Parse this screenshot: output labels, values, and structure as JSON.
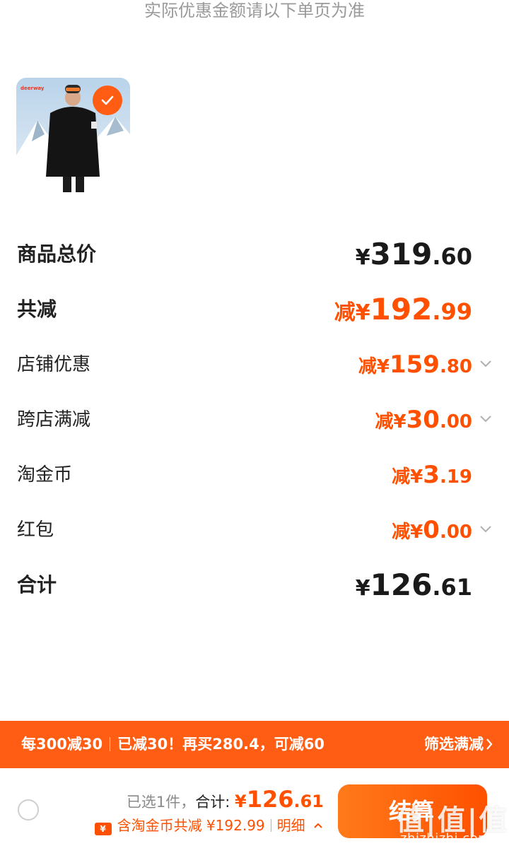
{
  "notice": "实际优惠金额请以下单页为准",
  "product": {
    "image_alt": "deerway",
    "selected": true
  },
  "rows": [
    {
      "label": "商品总价",
      "prefix": "¥",
      "int": "319",
      "dec": ".60",
      "style": "total"
    },
    {
      "label": "共减",
      "prefix": "减¥",
      "int": "192",
      "dec": ".99",
      "style": "discount-total"
    },
    {
      "label": "店铺优惠",
      "prefix": "减¥",
      "int": "159",
      "dec": ".80",
      "expandable": true
    },
    {
      "label": "跨店满减",
      "prefix": "减¥",
      "int": "30",
      "dec": ".00",
      "expandable": true
    },
    {
      "label": "淘金币",
      "prefix": "减¥",
      "int": "3",
      "dec": ".19",
      "expandable": false
    },
    {
      "label": "红包",
      "prefix": "减¥",
      "int": "0",
      "dec": ".00",
      "expandable": true
    },
    {
      "label": "合计",
      "prefix": "¥",
      "int": "126",
      "dec": ".61",
      "style": "total"
    }
  ],
  "promo": {
    "rule": "每300减30",
    "status": "已减30！再买280.4，可减60",
    "filter_label": "筛选满减"
  },
  "footer": {
    "selected_count": "已选1件，",
    "total_label": "合计: ",
    "total_prefix": "¥",
    "total_int": "126",
    "total_dec": ".61",
    "savings_text": "含淘金币共减 ¥192.99",
    "details_label": "明细",
    "checkout_label": "结算"
  },
  "watermark": {
    "logo": "值|值|值",
    "url": "zhizhizhi.com"
  },
  "colors": {
    "accent": "#ff5000",
    "promo_bg": "#ff5d14",
    "text": "#1f1f1f",
    "muted": "#9a9a9a"
  }
}
